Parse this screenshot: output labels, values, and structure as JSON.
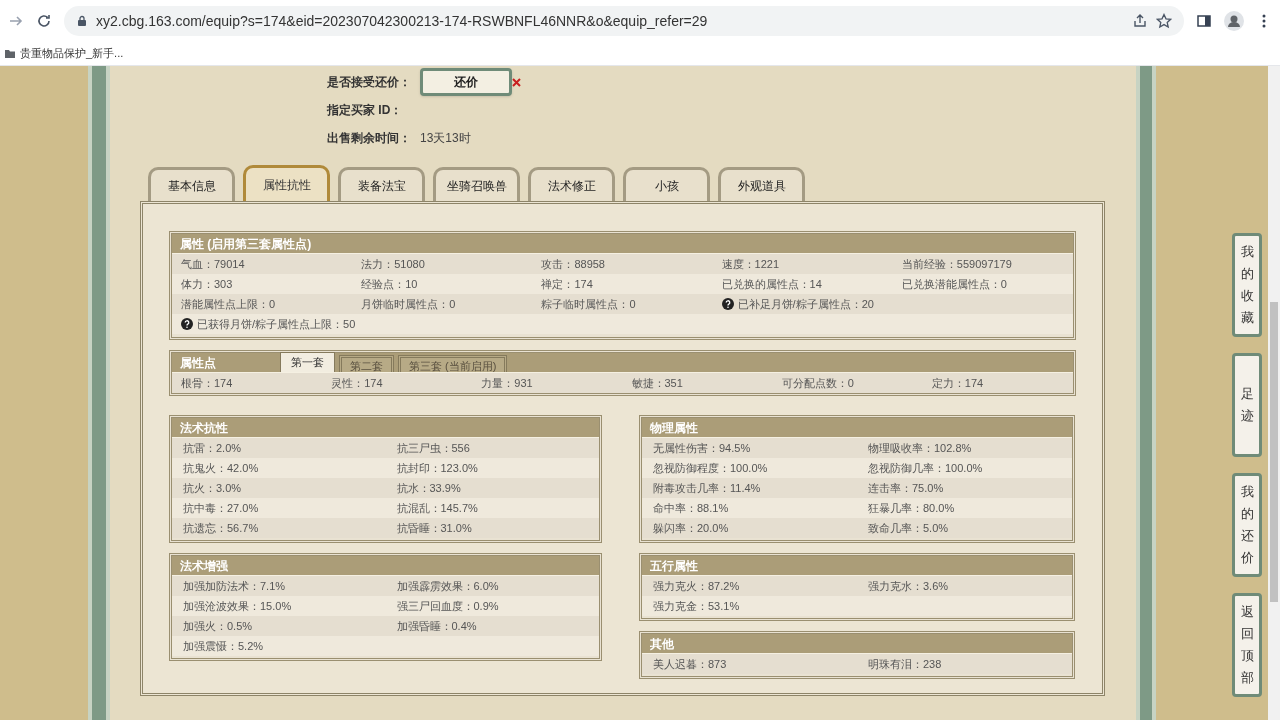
{
  "browser": {
    "url": "xy2.cbg.163.com/equip?s=174&eid=202307042300213-174-RSWBNFL46NNR&o&equip_refer=29",
    "bookmark": "贵重物品保护_新手..."
  },
  "info": [
    {
      "label": "是否接受还价：",
      "kind": "button",
      "value": "还价"
    },
    {
      "label": "指定买家 ID：",
      "kind": "text"
    },
    {
      "label": "出售剩余时间：",
      "kind": "text",
      "value": "13天13时"
    }
  ],
  "tabs": [
    {
      "label": "基本信息",
      "selected": false
    },
    {
      "label": "属性抗性",
      "selected": true
    },
    {
      "label": "装备法宝",
      "selected": false
    },
    {
      "label": "坐骑召唤兽",
      "selected": false
    },
    {
      "label": "法术修正",
      "selected": false
    },
    {
      "label": "小孩",
      "selected": false
    },
    {
      "label": "外观道具",
      "selected": false
    }
  ],
  "attributes": {
    "title": "属性 (启用第三套属性点)",
    "rows": [
      [
        {
          "text": "气血：79014",
          "help": false
        },
        {
          "text": "法力：51080",
          "help": false
        },
        {
          "text": "攻击：88958",
          "help": false
        },
        {
          "text": "速度：1221",
          "help": false
        },
        {
          "text": "当前经验：559097179",
          "help": false
        }
      ],
      [
        {
          "text": "体力：303",
          "help": false
        },
        {
          "text": "经验点：10",
          "help": false
        },
        {
          "text": "禅定：174",
          "help": false
        },
        {
          "text": "已兑换的属性点：14",
          "help": false
        },
        {
          "text": "已兑换潜能属性点：0",
          "help": false
        }
      ],
      [
        {
          "text": "潜能属性点上限：0",
          "help": false
        },
        {
          "text": "月饼临时属性点：0",
          "help": false
        },
        {
          "text": "粽子临时属性点：0",
          "help": false
        },
        {
          "text": "已补足月饼/粽子属性点：20",
          "help": true
        }
      ],
      [
        {
          "text": "已获得月饼/粽子属性点上限：50",
          "help": true
        }
      ]
    ]
  },
  "points": {
    "title": "属性点",
    "tabs": [
      {
        "label": "第一套",
        "selected": true
      },
      {
        "label": "第二套",
        "selected": false
      },
      {
        "label": "第三套 (当前启用)",
        "selected": false
      }
    ],
    "values": [
      "根骨：174",
      "灵性：174",
      "力量：931",
      "敏捷：351",
      "可分配点数：0",
      "定力：174"
    ]
  },
  "left_sections": [
    {
      "title": "法术抗性",
      "rows": [
        [
          "抗雷：2.0%",
          "抗三尸虫：556"
        ],
        [
          "抗鬼火：42.0%",
          "抗封印：123.0%"
        ],
        [
          "抗火：3.0%",
          "抗水：33.9%"
        ],
        [
          "抗中毒：27.0%",
          "抗混乱：145.7%"
        ],
        [
          "抗遗忘：56.7%",
          "抗昏睡：31.0%"
        ]
      ]
    },
    {
      "title": "法术增强",
      "rows": [
        [
          "加强加防法术：7.1%",
          "加强霹雳效果：6.0%"
        ],
        [
          "加强沧波效果：15.0%",
          "强三尸回血度：0.9%"
        ],
        [
          "加强火：0.5%",
          "加强昏睡：0.4%"
        ],
        [
          "加强震慑：5.2%"
        ]
      ]
    }
  ],
  "right_sections": [
    {
      "title": "物理属性",
      "rows": [
        [
          "无属性伤害：94.5%",
          "物理吸收率：102.8%"
        ],
        [
          "忽视防御程度：100.0%",
          "忽视防御几率：100.0%"
        ],
        [
          "附毒攻击几率：11.4%",
          "连击率：75.0%"
        ],
        [
          "命中率：88.1%",
          "狂暴几率：80.0%"
        ],
        [
          "躲闪率：20.0%",
          "致命几率：5.0%"
        ]
      ]
    },
    {
      "title": "五行属性",
      "rows": [
        [
          "强力克火：87.2%",
          "强力克水：3.6%"
        ],
        [
          "强力克金：53.1%"
        ]
      ]
    },
    {
      "title": "其他",
      "rows": [
        [
          "美人迟暮：873",
          "明珠有泪：238"
        ]
      ]
    }
  ],
  "side_buttons": [
    "我的收藏",
    "足迹",
    "我的还价",
    "返回顶部"
  ]
}
